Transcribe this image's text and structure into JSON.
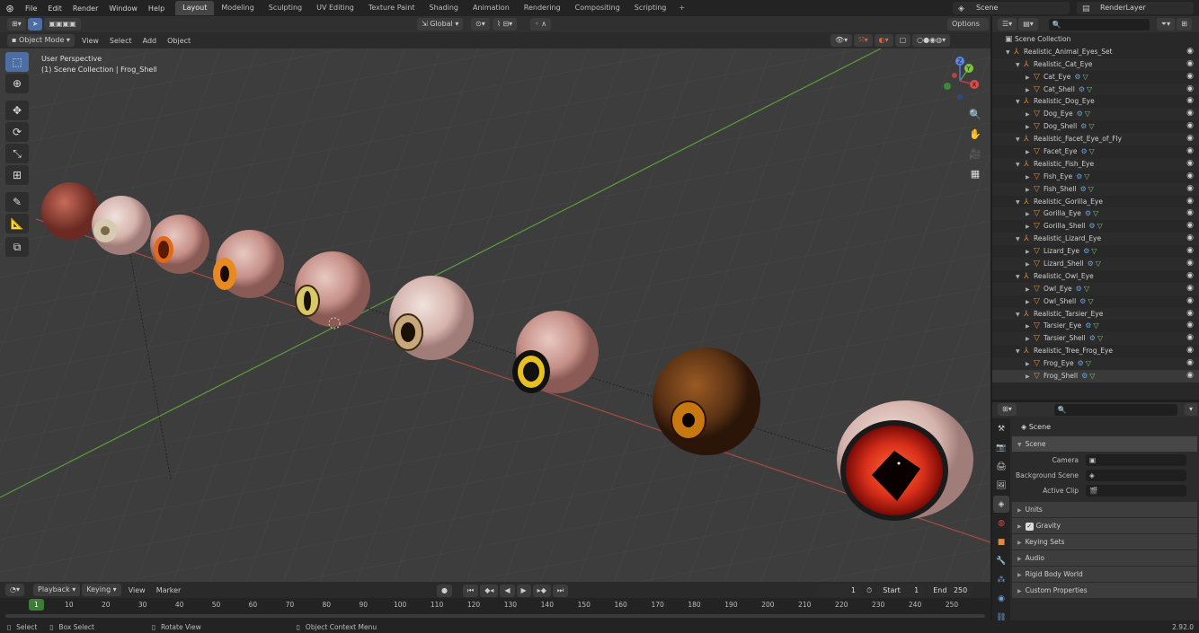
{
  "topbar": {
    "menus": [
      "File",
      "Edit",
      "Render",
      "Window",
      "Help"
    ],
    "workspaces": [
      "Layout",
      "Modeling",
      "Sculpting",
      "UV Editing",
      "Texture Paint",
      "Shading",
      "Animation",
      "Rendering",
      "Compositing",
      "Scripting"
    ],
    "plus": "+",
    "scene": "Scene",
    "render_layer": "RenderLayer"
  },
  "header": {
    "transform_orientation": "Global",
    "options": "Options"
  },
  "viewport_header": {
    "mode": "Object Mode",
    "menus": [
      "View",
      "Select",
      "Add",
      "Object"
    ]
  },
  "viewport": {
    "perspective": "User Perspective",
    "collection_info": "(1) Scene Collection | Frog_Shell",
    "gizmo": {
      "x": "X",
      "y": "Y",
      "z": "Z"
    }
  },
  "outliner": {
    "root": "Scene Collection",
    "rows": [
      {
        "label": "Realistic_Animal_Eyes_Set",
        "level": 1,
        "kind": "empty"
      },
      {
        "label": "Realistic_Cat_Eye",
        "level": 2,
        "kind": "empty"
      },
      {
        "label": "Cat_Eye",
        "level": 3,
        "kind": "mesh"
      },
      {
        "label": "Cat_Shell",
        "level": 3,
        "kind": "mesh"
      },
      {
        "label": "Realistic_Dog_Eye",
        "level": 2,
        "kind": "empty"
      },
      {
        "label": "Dog_Eye",
        "level": 3,
        "kind": "mesh"
      },
      {
        "label": "Dog_Shell",
        "level": 3,
        "kind": "mesh"
      },
      {
        "label": "Realistic_Facet_Eye_of_Fly",
        "level": 2,
        "kind": "empty"
      },
      {
        "label": "Facet_Eye",
        "level": 3,
        "kind": "mesh"
      },
      {
        "label": "Realistic_Fish_Eye",
        "level": 2,
        "kind": "empty"
      },
      {
        "label": "Fish_Eye",
        "level": 3,
        "kind": "mesh"
      },
      {
        "label": "Fish_Shell",
        "level": 3,
        "kind": "mesh"
      },
      {
        "label": "Realistic_Gorilla_Eye",
        "level": 2,
        "kind": "empty"
      },
      {
        "label": "Gorilla_Eye",
        "level": 3,
        "kind": "mesh"
      },
      {
        "label": "Gorilla_Shell",
        "level": 3,
        "kind": "mesh"
      },
      {
        "label": "Realistic_Lizard_Eye",
        "level": 2,
        "kind": "empty"
      },
      {
        "label": "Lizard_Eye",
        "level": 3,
        "kind": "mesh"
      },
      {
        "label": "Lizard_Shell",
        "level": 3,
        "kind": "mesh"
      },
      {
        "label": "Realistic_Owl_Eye",
        "level": 2,
        "kind": "empty"
      },
      {
        "label": "Owl_Eye",
        "level": 3,
        "kind": "mesh"
      },
      {
        "label": "Owl_Shell",
        "level": 3,
        "kind": "mesh"
      },
      {
        "label": "Realistic_Tarsier_Eye",
        "level": 2,
        "kind": "empty"
      },
      {
        "label": "Tarsier_Eye",
        "level": 3,
        "kind": "mesh"
      },
      {
        "label": "Tarsier_Shell",
        "level": 3,
        "kind": "mesh"
      },
      {
        "label": "Realistic_Tree_Frog_Eye",
        "level": 2,
        "kind": "empty"
      },
      {
        "label": "Frog_Eye",
        "level": 3,
        "kind": "mesh"
      },
      {
        "label": "Frog_Shell",
        "level": 3,
        "kind": "mesh"
      }
    ]
  },
  "properties": {
    "title": "Scene",
    "section": "Scene",
    "camera_label": "Camera",
    "background_label": "Background Scene",
    "clip_label": "Active Clip",
    "sections": [
      "Units",
      "Gravity",
      "Keying Sets",
      "Audio",
      "Rigid Body World",
      "Custom Properties"
    ],
    "gravity_checked": true
  },
  "timeline": {
    "playback": "Playback",
    "keying": "Keying",
    "view": "View",
    "marker": "Marker",
    "current_frame": "1",
    "start_label": "Start",
    "start": "1",
    "end_label": "End",
    "end": "250",
    "ruler": [
      "1",
      "10",
      "20",
      "30",
      "40",
      "50",
      "60",
      "70",
      "80",
      "90",
      "100",
      "110",
      "120",
      "130",
      "140",
      "150",
      "160",
      "170",
      "180",
      "190",
      "200",
      "210",
      "220",
      "230",
      "240",
      "250"
    ]
  },
  "statusbar": {
    "select": "Select",
    "box_select": "Box Select",
    "rotate_view": "Rotate View",
    "context_menu": "Object Context Menu",
    "version": "2.92.0"
  },
  "colors": {
    "accent": "#4b6fa5",
    "active_frame": "#3d7e35",
    "object": "#e08a3c",
    "x_axis": "#c0403a",
    "y_axis": "#5a9e3a"
  }
}
